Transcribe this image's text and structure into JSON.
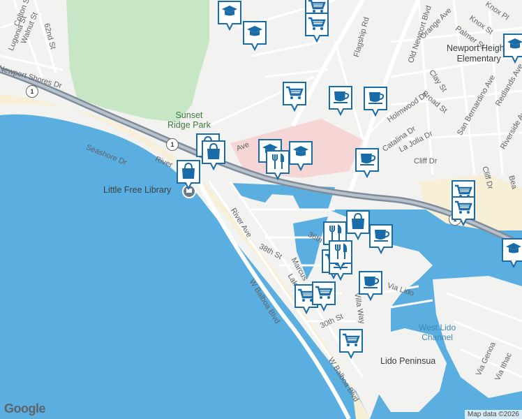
{
  "map": {
    "colors": {
      "land": "#f2f2f0",
      "ocean": "#5aaee0",
      "harbor": "#5aaee0",
      "park": "#c6e6c6",
      "beach": "#f7efd6",
      "road_major": "#7f8c9a",
      "road": "#ffffff",
      "commercial": "#f6d5d5",
      "pin": "#1a6ca8"
    },
    "labels": {
      "sunset_ridge_park": "Sunset\nRidge Park",
      "newport_heights": "Newport Heights\nElementary",
      "little_free_library": "Little Free Library",
      "west_lido_channel": "West Lido\nChannel",
      "lido_peninsula": "Lido Peninsua",
      "w_balboa_blvd_1": "W Balboa Blvd",
      "w_balboa_blvd_2": "W Balboa Blvd",
      "river_ave": "River Ave",
      "seashore_dr": "Seashore Dr",
      "newport_shores_dr": "Newport Shores Dr",
      "walnut_st": "Walnut St",
      "lugonia_st": "Lugonia St",
      "colton_st": "Colton St",
      "st_62nd": "62nd St",
      "flagship_rd": "Flagship Rd",
      "old_newport_blvd": "Old Newport Blvd",
      "orange_ave": "Orange Ave",
      "knox_st": "Knox St",
      "palmer_st": "Palmer St",
      "clay_st": "Clay St",
      "broad_st": "Broad St",
      "holmwood_dr": "Holmwood Dr",
      "catalina_dr": "Catalina Dr",
      "la_jolla_dr": "La Jolla Dr",
      "cliff_dr": "Cliff Dr",
      "san_bernardino_ave": "San Bernardino Ave",
      "redlands_ave": "Redlands Ave",
      "riverside_ave": "Riverside Ave",
      "cliff_dr_2": "Cliff Dr",
      "st_38th": "38th St",
      "st_36th": "36th",
      "st_30th": "30th St",
      "marcus": "Marcus",
      "lake": "Lake",
      "via_lido": "Via Lido",
      "villa_way": "Villa Way",
      "via_genoa": "Via Genoa",
      "via_ithaca": "Via Ithac",
      "ave_fragment": "Ave",
      "rive_fragment": "River",
      "bea_fragment": "Bea",
      "knox_pl": "Knox Pl",
      "highway_1a": "1",
      "highway_1b": "1",
      "highway_1c": "1"
    },
    "attribution": "Map data ©2026",
    "logo": "Google",
    "pins": [
      {
        "icon": "school-icon"
      },
      {
        "icon": "school-icon"
      },
      {
        "icon": "school-icon"
      },
      {
        "icon": "school-icon"
      },
      {
        "icon": "school-icon"
      },
      {
        "icon": "school-icon"
      },
      {
        "icon": "shopping-cart-icon"
      },
      {
        "icon": "shopping-cart-icon"
      },
      {
        "icon": "shopping-cart-icon"
      },
      {
        "icon": "shopping-cart-icon"
      },
      {
        "icon": "shopping-cart-icon"
      },
      {
        "icon": "shopping-cart-icon"
      },
      {
        "icon": "shopping-cart-icon"
      },
      {
        "icon": "shopping-cart-icon"
      },
      {
        "icon": "shopping-cart-icon"
      },
      {
        "icon": "coffee-cup-icon"
      },
      {
        "icon": "coffee-cup-icon"
      },
      {
        "icon": "coffee-cup-icon"
      },
      {
        "icon": "coffee-cup-icon"
      },
      {
        "icon": "coffee-cup-icon"
      },
      {
        "icon": "coffee-cup-icon"
      },
      {
        "icon": "restaurant-icon"
      },
      {
        "icon": "restaurant-icon"
      },
      {
        "icon": "restaurant-icon"
      },
      {
        "icon": "shopping-bag-icon"
      },
      {
        "icon": "shopping-bag-icon"
      },
      {
        "icon": "shopping-bag-icon"
      },
      {
        "icon": "shopping-bag-icon"
      }
    ]
  }
}
